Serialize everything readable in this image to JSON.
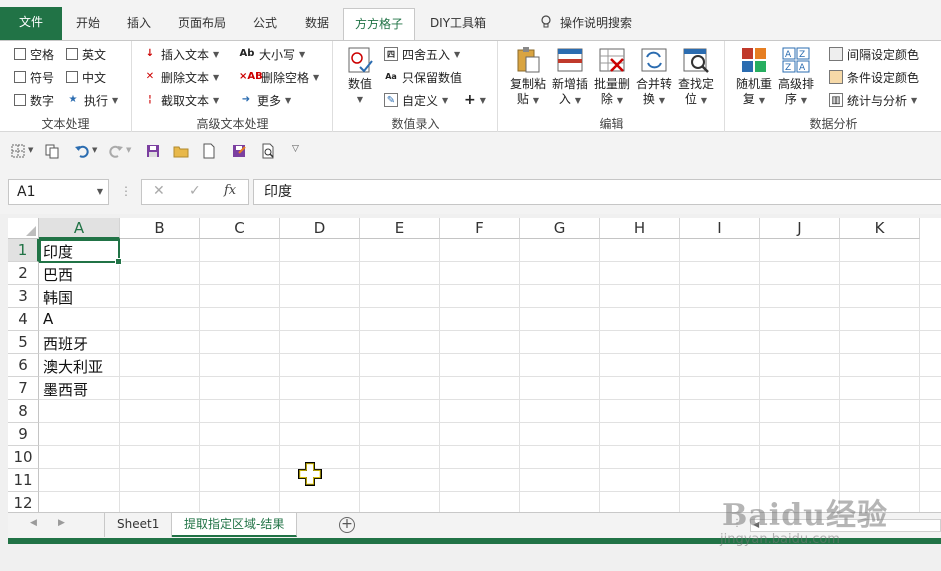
{
  "tabs": [
    {
      "label": "文件"
    },
    {
      "label": "开始"
    },
    {
      "label": "插入"
    },
    {
      "label": "页面布局"
    },
    {
      "label": "公式"
    },
    {
      "label": "数据"
    },
    {
      "label": "方方格子"
    },
    {
      "label": "DIY工具箱"
    }
  ],
  "tell_me": "操作说明搜索",
  "ribbon": {
    "text_group": {
      "label": "文本处理",
      "checks": [
        "空格",
        "英文",
        "符号",
        "中文",
        "数字"
      ],
      "execute": "执行"
    },
    "advtext_group": {
      "label": "高级文本处理",
      "items": [
        "插入文本",
        "删除文本",
        "截取文本",
        "大小写",
        "删除空格",
        "更多"
      ]
    },
    "numeric_group": {
      "label": "数值录入",
      "value_btn": "数值",
      "items": [
        "四舍五入",
        "只保留数值",
        "自定义"
      ],
      "plus": "+"
    },
    "edit_group": {
      "label": "编辑",
      "buttons": [
        {
          "l1": "复制粘",
          "l2": "贴"
        },
        {
          "l1": "新增插",
          "l2": "入"
        },
        {
          "l1": "批量删",
          "l2": "除"
        },
        {
          "l1": "合并转",
          "l2": "换"
        },
        {
          "l1": "查找定",
          "l2": "位"
        }
      ]
    },
    "analysis_group": {
      "label": "数据分析",
      "buttons": [
        {
          "l1": "随机重",
          "l2": "复"
        },
        {
          "l1": "高级排",
          "l2": "序"
        }
      ],
      "items": [
        "间隔设定颜色",
        "条件设定颜色",
        "统计与分析"
      ]
    }
  },
  "formula_bar": {
    "name_box": "A1",
    "cancel": "✕",
    "enter": "✓",
    "fx": "fx",
    "content": "印度"
  },
  "columns": [
    "A",
    "B",
    "C",
    "D",
    "E",
    "F",
    "G",
    "H",
    "I",
    "J",
    "K"
  ],
  "rows": [
    "1",
    "2",
    "3",
    "4",
    "5",
    "6",
    "7",
    "8",
    "9",
    "10",
    "11",
    "12"
  ],
  "cells_a": [
    "印度",
    "巴西",
    "韩国",
    "A",
    "西班牙",
    "澳大利亚",
    "墨西哥"
  ],
  "sheets": [
    {
      "name": "Sheet1"
    },
    {
      "name": "提取指定区域-结果"
    }
  ],
  "watermark": {
    "line1": "Baidu经验",
    "line2": "jingyan.baidu.com"
  },
  "colors": {
    "accent": "#217346"
  }
}
